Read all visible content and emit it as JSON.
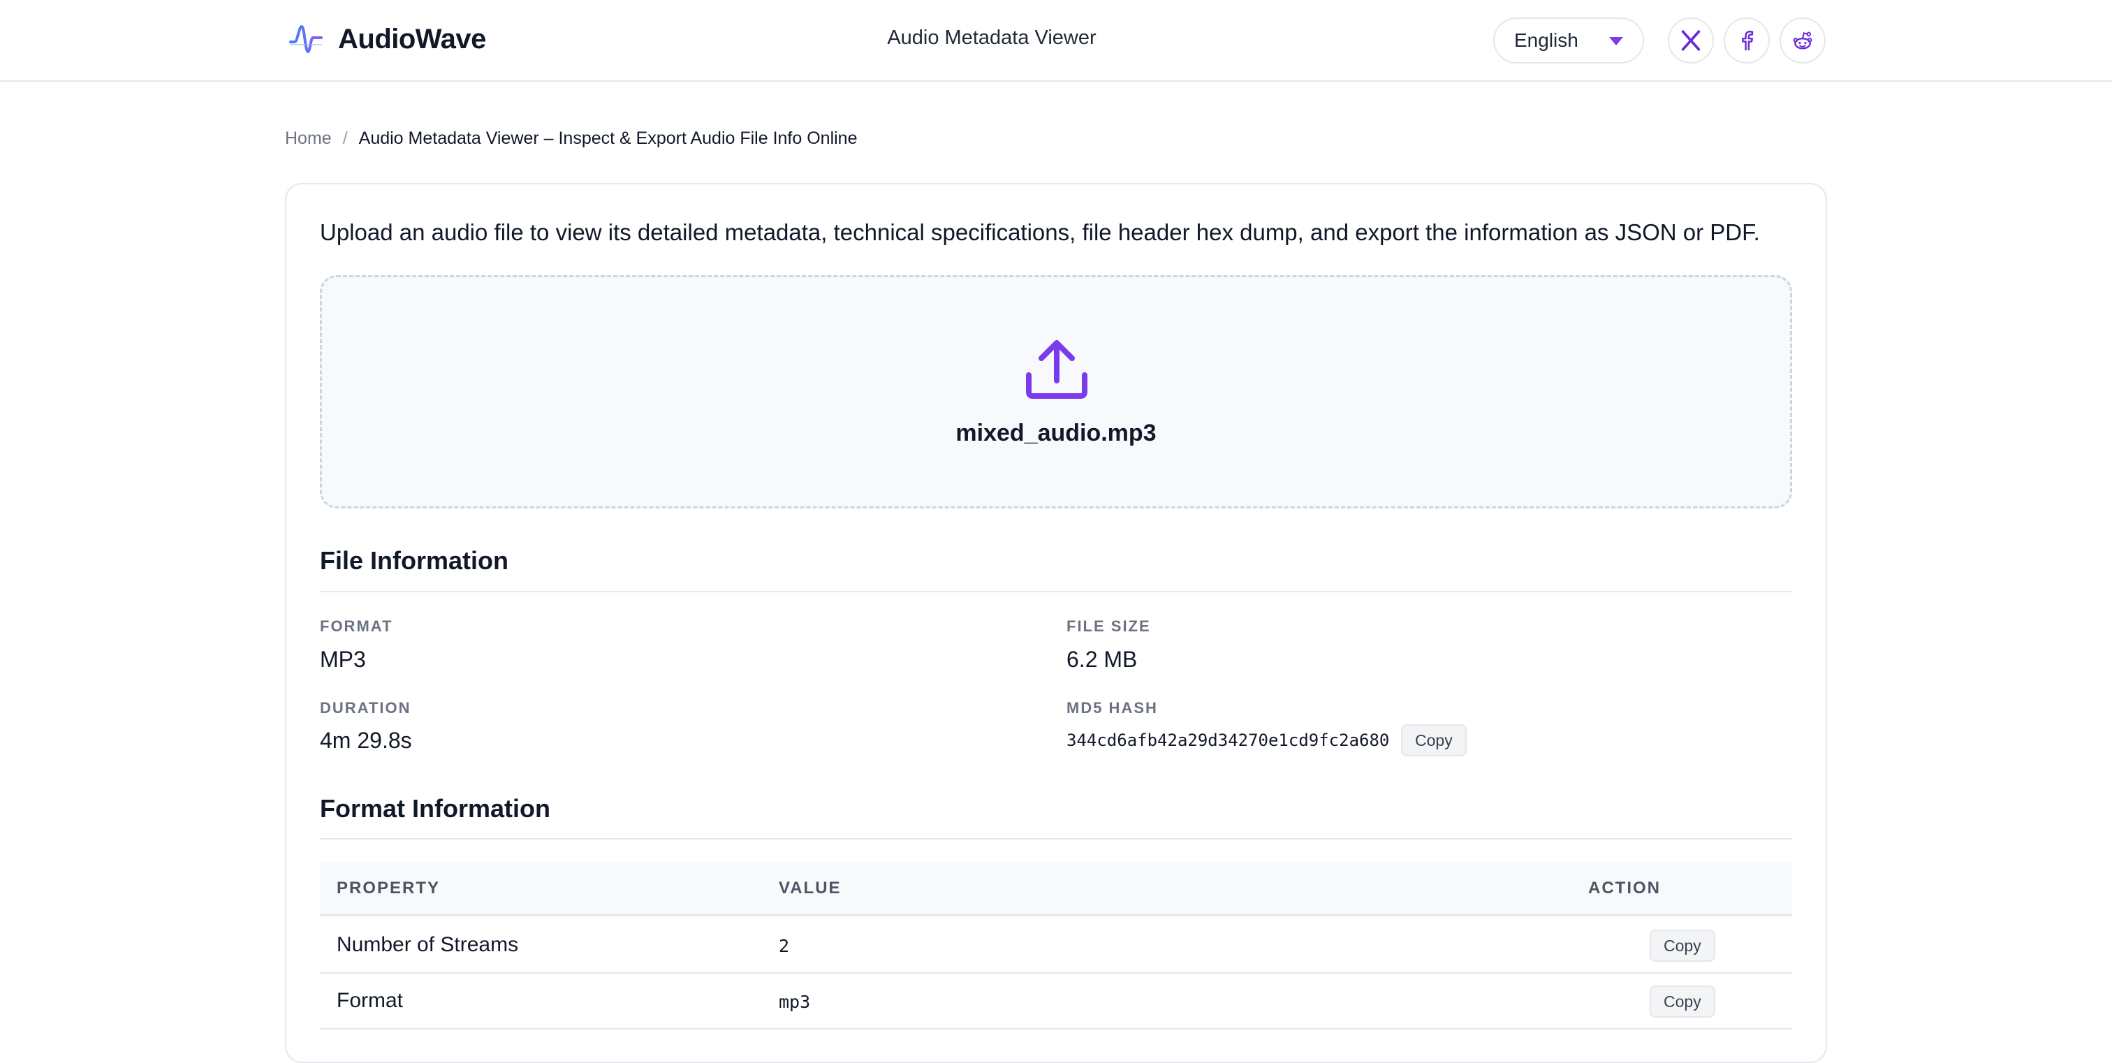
{
  "header": {
    "brand": "AudioWave",
    "title": "Audio Metadata Viewer",
    "language": "English",
    "social_icons": [
      "x-icon",
      "facebook-icon",
      "reddit-icon"
    ]
  },
  "breadcrumb": {
    "home": "Home",
    "separator": "/",
    "current": "Audio Metadata Viewer – Inspect & Export Audio File Info Online"
  },
  "intro": "Upload an audio file to view its detailed metadata, technical specifications, file header hex dump, and export the information as JSON or PDF.",
  "dropzone": {
    "icon": "upload-icon",
    "filename": "mixed_audio.mp3"
  },
  "file_info": {
    "title": "File Information",
    "format_label": "Format",
    "format_value": "MP3",
    "filesize_label": "File Size",
    "filesize_value": "6.2 MB",
    "duration_label": "Duration",
    "duration_value": "4m 29.8s",
    "md5_label": "MD5 Hash",
    "md5_value": "344cd6afb42a29d34270e1cd9fc2a680",
    "copy_label": "Copy"
  },
  "format_info": {
    "title": "Format Information",
    "columns": [
      "Property",
      "Value",
      "Action"
    ],
    "rows": [
      {
        "property": "Number of Streams",
        "value": "2",
        "action": "Copy"
      },
      {
        "property": "Format",
        "value": "mp3",
        "action": "Copy"
      }
    ]
  },
  "colors": {
    "accent": "#7c3aed",
    "border": "#e5e7eb",
    "dropzone_bg": "#f8f9fc",
    "text": "#111827",
    "muted": "#6b7280"
  }
}
